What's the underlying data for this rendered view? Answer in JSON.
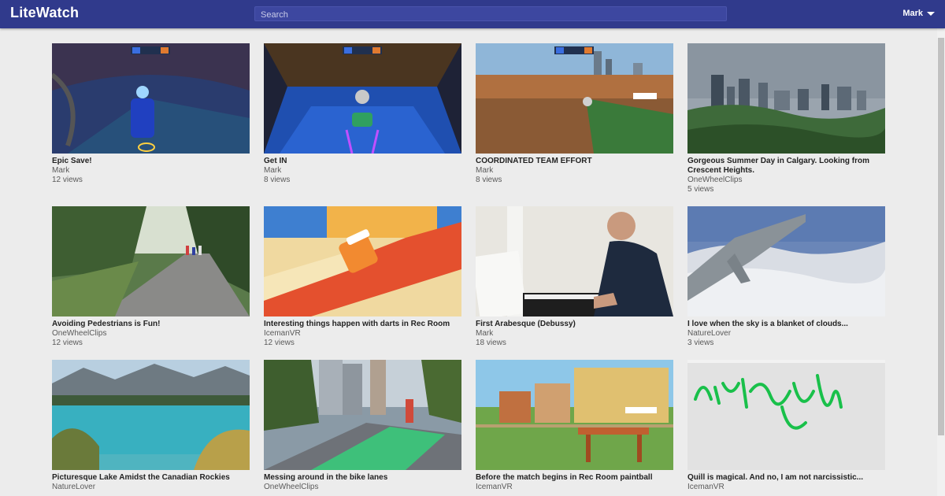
{
  "app": {
    "brand": "LiteWatch",
    "search_placeholder": "Search",
    "user_name": "Mark",
    "caret_icon": "caret-down-icon"
  },
  "videos": [
    {
      "title": "Epic Save!",
      "channel": "Mark",
      "views": "12 views"
    },
    {
      "title": "Get IN",
      "channel": "Mark",
      "views": "8 views"
    },
    {
      "title": "COORDINATED TEAM EFFORT",
      "channel": "Mark",
      "views": "8 views"
    },
    {
      "title": "Gorgeous Summer Day in Calgary. Looking from Crescent Heights.",
      "channel": "OneWheelClips",
      "views": "5 views"
    },
    {
      "title": "Avoiding Pedestrians is Fun!",
      "channel": "OneWheelClips",
      "views": "12 views"
    },
    {
      "title": "Interesting things happen with darts in Rec Room",
      "channel": "IcemanVR",
      "views": "12 views"
    },
    {
      "title": "First Arabesque (Debussy)",
      "channel": "Mark",
      "views": "18 views"
    },
    {
      "title": "I love when the sky is a blanket of clouds...",
      "channel": "NatureLover",
      "views": "3 views"
    },
    {
      "title": "Picturesque Lake Amidst the Canadian Rockies",
      "channel": "NatureLover",
      "views": ""
    },
    {
      "title": "Messing around in the bike lanes",
      "channel": "OneWheelClips",
      "views": ""
    },
    {
      "title": "Before the match begins in Rec Room paintball",
      "channel": "IcemanVR",
      "views": ""
    },
    {
      "title": "Quill is magical. And no, I am not narcissistic...",
      "channel": "IcemanVR",
      "views": ""
    }
  ]
}
